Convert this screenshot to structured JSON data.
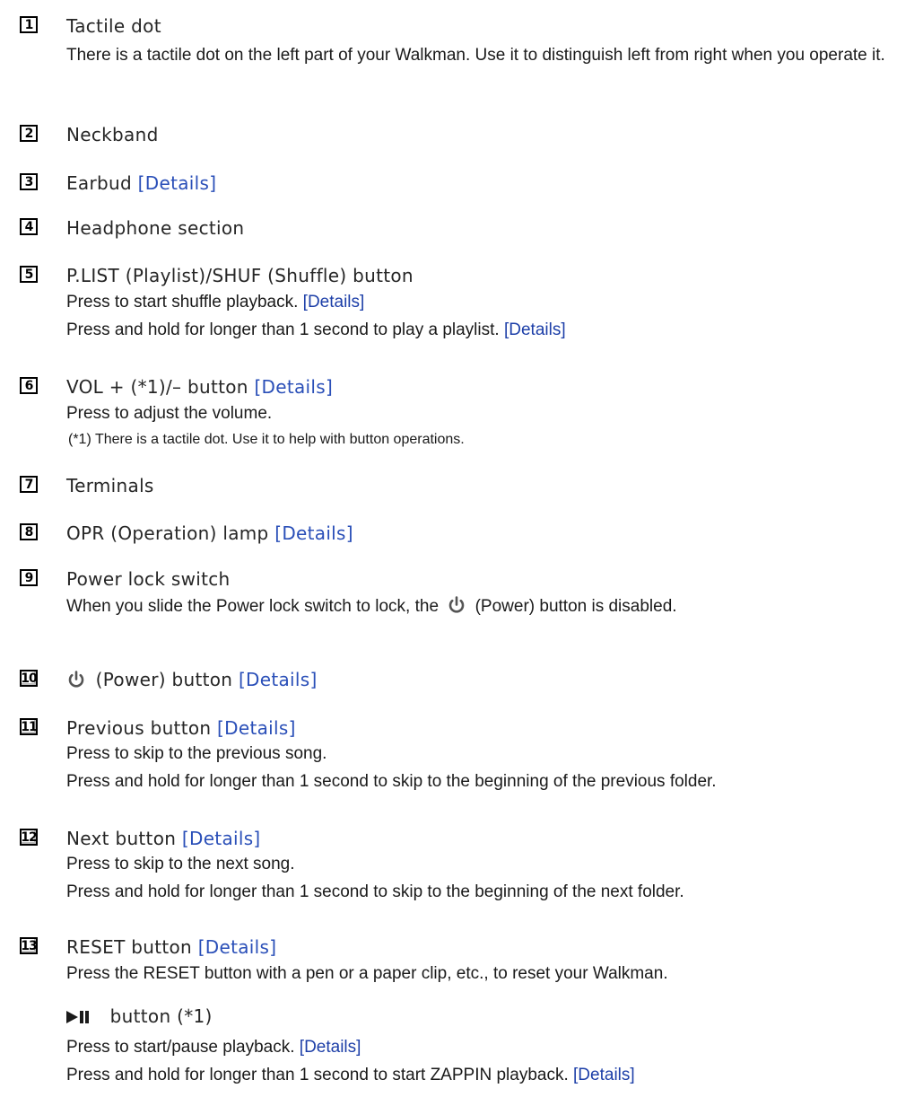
{
  "items": [
    {
      "number": "1",
      "title": "Tactile dot",
      "desc": "There is a tactile dot on the left part of your Walkman. Use it to distinguish left from right when you operate it."
    },
    {
      "number": "2",
      "title": "Neckband"
    },
    {
      "number": "3",
      "title": "Earbud",
      "link": "[Details]"
    },
    {
      "number": "4",
      "title": "Headphone section"
    },
    {
      "number": "5",
      "title": "P.LIST (Playlist)/SHUF (Shuffle) button",
      "desc1": "Press to start shuffle playback.",
      "desc1_link": "[Details]",
      "desc2": "Press and hold for longer than 1 second to play a playlist.",
      "desc2_link": "[Details]"
    },
    {
      "number": "6",
      "title": "VOL + (*1)/– button",
      "link": "[Details]",
      "desc1": "Press to adjust the volume.",
      "note": "(*1) There is a tactile dot. Use it to help with button operations."
    },
    {
      "number": "7",
      "title": "Terminals"
    },
    {
      "number": "8",
      "title": "OPR (Operation) lamp",
      "link": "[Details]"
    },
    {
      "number": "9",
      "title": "Power lock switch",
      "desc_before": "When you slide the Power lock switch to lock, the",
      "desc_after": "(Power) button is disabled."
    },
    {
      "number": "10",
      "title": "(Power) button",
      "link": "[Details]"
    },
    {
      "number": "11",
      "title": "Previous button",
      "link": "[Details]",
      "desc1": "Press to skip to the previous song.",
      "desc2": "Press and hold for longer than 1 second to skip to the beginning of the previous folder."
    },
    {
      "number": "12",
      "title": "Next button",
      "link": "[Details]",
      "desc1": "Press to skip to the next song.",
      "desc2": "Press and hold for longer than 1 second to skip to the beginning of the next folder."
    },
    {
      "number": "13",
      "title": "RESET button",
      "link": "[Details]",
      "desc1": "Press the RESET button with a pen or a paper clip, etc., to reset your Walkman.",
      "sub_title": "button (*1)",
      "sub_desc1": "Press to start/pause playback.",
      "sub_desc1_link": "[Details]",
      "sub_desc2": "Press and hold for longer than 1 second to start ZAPPIN playback.",
      "sub_desc2_link": "[Details]"
    }
  ],
  "icons": {
    "power": "power-icon",
    "play_pause": "play-pause-icon"
  }
}
